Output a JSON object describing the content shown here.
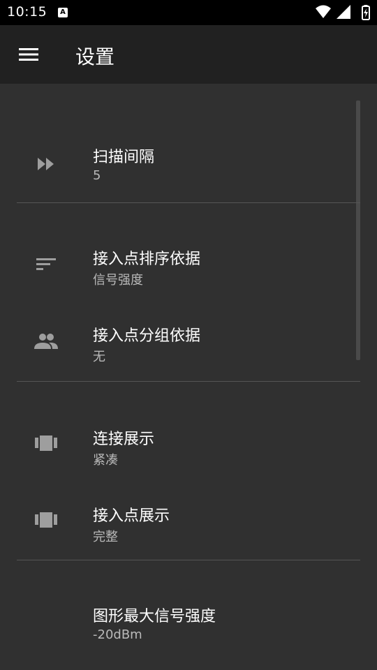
{
  "status_bar": {
    "time": "10:15",
    "badge_letter": "A",
    "icons": [
      "notification-a-icon",
      "wifi-icon",
      "signal-icon",
      "battery-icon"
    ]
  },
  "app_bar": {
    "title": "设置",
    "menu_icon": "menu-icon"
  },
  "settings": {
    "items": [
      {
        "icon": "fast-forward-icon",
        "title": "扫描间隔",
        "summary": "5"
      },
      {
        "icon": "sort-icon",
        "title": "接入点排序依据",
        "summary": "信号强度"
      },
      {
        "icon": "people-icon",
        "title": "接入点分组依据",
        "summary": "无"
      },
      {
        "icon": "view-carousel-icon",
        "title": "连接展示",
        "summary": "紧凑"
      },
      {
        "icon": "view-carousel-icon",
        "title": "接入点展示",
        "summary": "完整"
      },
      {
        "icon": "",
        "title": "图形最大信号强度",
        "summary": "-20dBm"
      }
    ]
  },
  "colors": {
    "background": "#303030",
    "app_bar": "#212121",
    "status_bar": "#000000",
    "icon": "#9e9e9e",
    "summary_text": "#b9b9b9",
    "divider": "#555555"
  }
}
